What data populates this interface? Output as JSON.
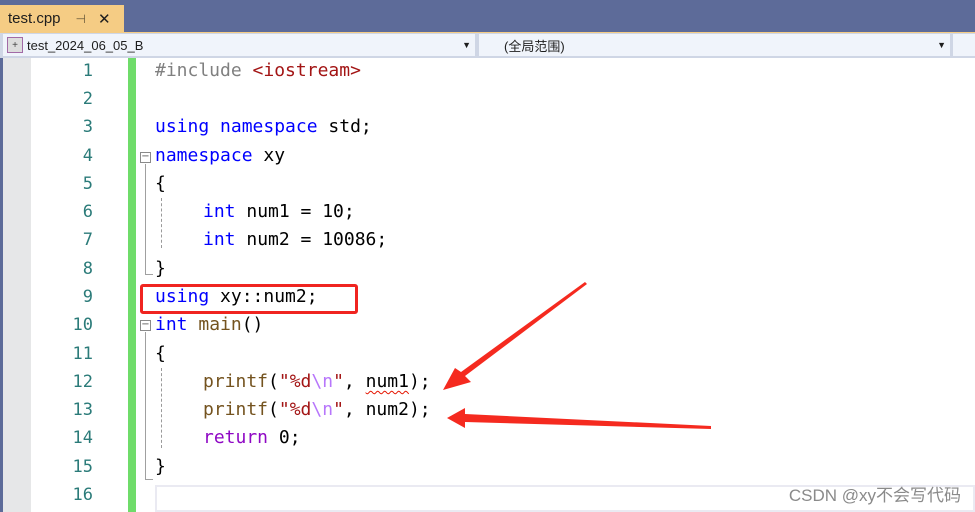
{
  "tab": {
    "title": "test.cpp",
    "pin_icon": "pin-icon",
    "close_icon": "close-icon"
  },
  "navigation": {
    "project_dropdown": "test_2024_06_05_B",
    "scope_dropdown": "(全局范围)"
  },
  "editor": {
    "lines": [
      {
        "n": "1"
      },
      {
        "n": "2"
      },
      {
        "n": "3"
      },
      {
        "n": "4"
      },
      {
        "n": "5"
      },
      {
        "n": "6"
      },
      {
        "n": "7"
      },
      {
        "n": "8"
      },
      {
        "n": "9"
      },
      {
        "n": "10"
      },
      {
        "n": "11"
      },
      {
        "n": "12"
      },
      {
        "n": "13"
      },
      {
        "n": "14"
      },
      {
        "n": "15"
      },
      {
        "n": "16"
      }
    ],
    "code": {
      "l1_pp": "#include ",
      "l1_inc": "<iostream>",
      "l3_kw1": "using",
      "l3_kw2": "namespace",
      "l3_rest": " std;",
      "l4_kw": "namespace",
      "l4_rest": " xy",
      "l5": "{",
      "l6_kw": "int",
      "l6_rest": " num1 = 10;",
      "l7_kw": "int",
      "l7_rest": " num2 = 10086;",
      "l8": "}",
      "l9_kw": "using",
      "l9_rest": " xy::num2;",
      "l10_kw": "int",
      "l10_fn": "main",
      "l10_rest": "()",
      "l11": "{",
      "l12_fn": "printf",
      "l12_p1": "(",
      "l12_s1": "\"%d",
      "l12_esc": "\\n",
      "l12_s2": "\"",
      "l12_p2": ", ",
      "l12_err": "num1",
      "l12_p3": ");",
      "l13_fn": "printf",
      "l13_p1": "(",
      "l13_s1": "\"%d",
      "l13_esc": "\\n",
      "l13_s2": "\"",
      "l13_rest": ", num2);",
      "l14_kw": "return",
      "l14_rest": " 0;",
      "l15": "}"
    },
    "annotations": {
      "highlight_color": "#f02420",
      "arrow_color": "#f52a1f"
    }
  },
  "watermark": "CSDN @xy不会写代码"
}
